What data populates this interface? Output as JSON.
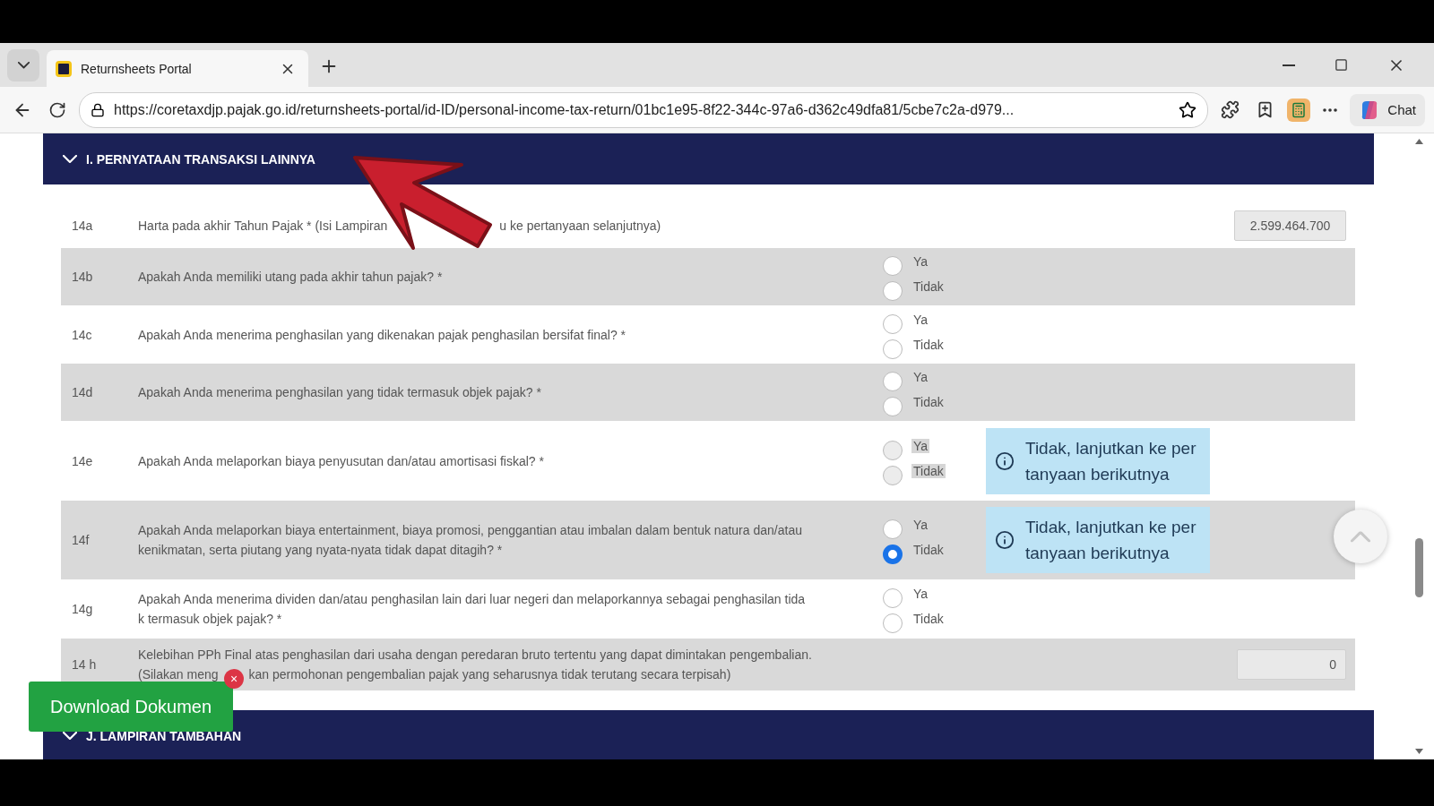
{
  "browser": {
    "tab_title": "Returnsheets Portal",
    "url": "https://coretaxdjp.pajak.go.id/returnsheets-portal/id-ID/personal-income-tax-return/01bc1e95-8f22-344c-97a6-d362c49dfa81/5cbe7c2a-d979...",
    "chat_label": "Chat"
  },
  "sections": [
    {
      "title": "I. PERNYATAAN TRANSAKSI LAINNYA",
      "expanded": true
    },
    {
      "title": "J. LAMPIRAN TAMBAHAN",
      "expanded": true
    }
  ],
  "rows": [
    {
      "number": "14a",
      "kind": "value",
      "question_parts": [
        "Harta pada akhir Tahun Pajak * (Isi Lampiran",
        "u ke pertanyaan selanjutnya)"
      ],
      "value": "2.599.464.700"
    },
    {
      "number": "14b",
      "kind": "radio",
      "question": "Apakah Anda memiliki utang pada akhir tahun pajak? *",
      "disabled": false,
      "options": [
        {
          "label": "Ya",
          "selected": false
        },
        {
          "label": "Tidak",
          "selected": false
        }
      ]
    },
    {
      "number": "14c",
      "kind": "radio",
      "question": "Apakah Anda menerima penghasilan yang dikenakan pajak penghasilan bersifat final? *",
      "disabled": false,
      "options": [
        {
          "label": "Ya",
          "selected": false
        },
        {
          "label": "Tidak",
          "selected": false
        }
      ]
    },
    {
      "number": "14d",
      "kind": "radio",
      "question": "Apakah Anda menerima penghasilan yang tidak termasuk objek pajak? *",
      "disabled": false,
      "options": [
        {
          "label": "Ya",
          "selected": false
        },
        {
          "label": "Tidak",
          "selected": false
        }
      ]
    },
    {
      "number": "14e",
      "kind": "radio",
      "question": "Apakah Anda melaporkan biaya penyusutan dan/atau amortisasi fiskal? *",
      "disabled": true,
      "options": [
        {
          "label": "Ya",
          "selected": false
        },
        {
          "label": "Tidak",
          "selected": false
        }
      ],
      "note": "Tidak, lanjutkan ke per\ntanyaan berikutnya"
    },
    {
      "number": "14f",
      "kind": "radio",
      "question": "Apakah Anda melaporkan biaya entertainment, biaya promosi, penggantian atau imbalan dalam bentuk natura dan/atau\nkenikmatan, serta piutang yang nyata-nyata tidak dapat ditagih? *",
      "disabled": false,
      "options": [
        {
          "label": "Ya",
          "selected": false
        },
        {
          "label": "Tidak",
          "selected": true
        }
      ],
      "note": "Tidak, lanjutkan ke per\ntanyaan berikutnya"
    },
    {
      "number": "14g",
      "kind": "radio",
      "question": "Apakah Anda menerima dividen dan/atau penghasilan lain dari luar negeri dan melaporkannya sebagai penghasilan tida\nk termasuk objek pajak? *",
      "disabled": false,
      "options": [
        {
          "label": "Ya",
          "selected": false
        },
        {
          "label": "Tidak",
          "selected": false
        }
      ]
    },
    {
      "number": "14 h",
      "kind": "value",
      "question_lines": [
        "Kelebihan PPh Final atas penghasilan dari usaha dengan peredaran bruto tertentu yang dapat dimintakan pengembalian.",
        [
          "(Silakan meng",
          "kan permohonan pengembalian pajak yang seharusnya tidak terutang secara terpisah)"
        ]
      ],
      "value": "0"
    }
  ],
  "download_button": {
    "label": "Download Dokumen",
    "close_label": "×"
  }
}
